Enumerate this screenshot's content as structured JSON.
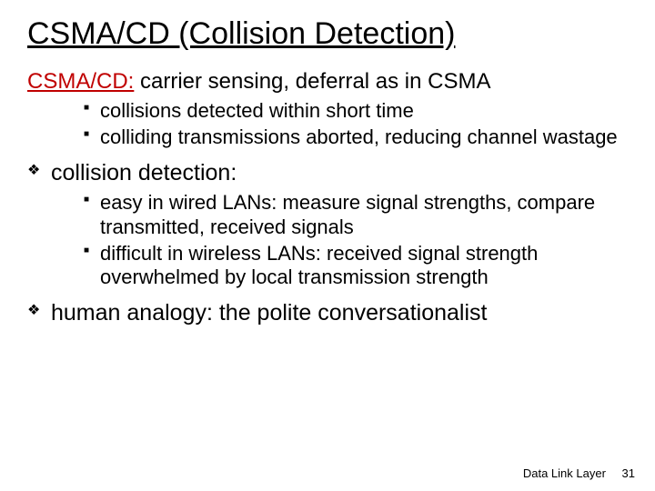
{
  "title": "CSMA/CD (Collision Detection)",
  "lead": {
    "red": "CSMA/CD:",
    "rest": " carrier sensing, deferral as in CSMA"
  },
  "sub1": [
    "collisions detected within short time",
    "colliding transmissions aborted, reducing channel wastage"
  ],
  "collision_label": "collision detection:",
  "sub2": [
    "easy in wired LANs: measure signal strengths, compare transmitted, received signals",
    "difficult in wireless LANs: received signal strength overwhelmed by local transmission strength"
  ],
  "human_analogy": "human analogy: the polite conversationalist",
  "footer": {
    "section": "Data Link Layer",
    "page": "31"
  }
}
